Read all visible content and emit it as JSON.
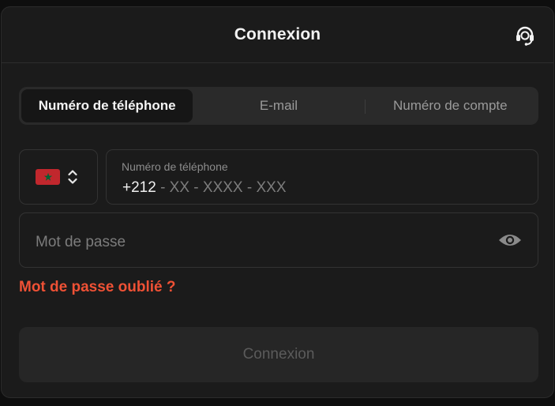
{
  "header": {
    "title": "Connexion",
    "support_icon": "headset-support-icon"
  },
  "tabs": [
    {
      "label": "Numéro de téléphone",
      "active": true
    },
    {
      "label": "E-mail",
      "active": false
    },
    {
      "label": "Numéro de compte",
      "active": false
    }
  ],
  "country": {
    "flag_icon": "morocco-flag-icon",
    "selector_icon": "chevron-up-down-icon"
  },
  "phone": {
    "label": "Numéro de téléphone",
    "dial_code": "+212",
    "mask": " - XX - XXXX - XXX"
  },
  "password": {
    "placeholder": "Mot de passe",
    "toggle_icon": "eye-icon"
  },
  "forgot_label": "Mot de passe oublié ?",
  "submit_label": "Connexion",
  "colors": {
    "background": "#1b1b1b",
    "accent_link": "#ef5135",
    "flag_red": "#c1272d",
    "flag_star": "#006233"
  }
}
